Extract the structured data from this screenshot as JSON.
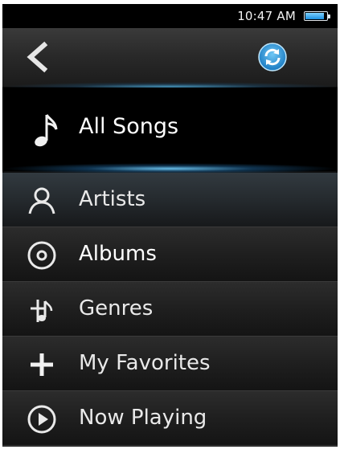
{
  "status_bar": {
    "time": "10:47 AM",
    "battery_icon": "battery-icon",
    "battery_level": 0.9
  },
  "header": {
    "back_icon": "chevron-left-icon",
    "sync_icon": "sync-icon",
    "accent_color": "#2a9fe4"
  },
  "selected": {
    "label": "All Songs",
    "icon": "music-note-icon"
  },
  "menu": {
    "items": [
      {
        "label": "Artists",
        "icon": "person-icon"
      },
      {
        "label": "Albums",
        "icon": "disc-icon"
      },
      {
        "label": "Genres",
        "icon": "genre-icon"
      },
      {
        "label": "My Favorites",
        "icon": "plus-icon"
      },
      {
        "label": "Now Playing",
        "icon": "play-icon"
      }
    ]
  }
}
